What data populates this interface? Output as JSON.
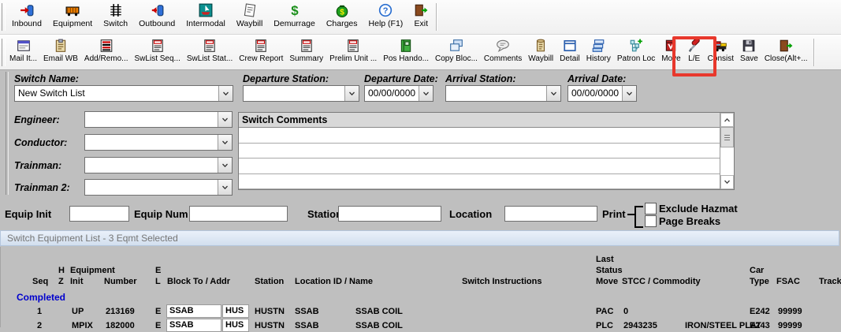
{
  "toolbar_main": {
    "items": [
      "Inbound",
      "Equipment",
      "Switch",
      "Outbound",
      "Intermodal",
      "Waybill",
      "Demurrage",
      "Charges",
      "Help (F1)",
      "Exit"
    ]
  },
  "toolbar_secondary": {
    "items": [
      "Mail It...",
      "Email WB",
      "Add/Remo...",
      "SwList Seq...",
      "SwList Stat...",
      "Crew Report",
      "Summary",
      "Prelim Unit ...",
      "Pos Hando...",
      "Copy Bloc...",
      "Comments",
      "Waybill",
      "Detail",
      "History",
      "Patron Loc",
      "Move",
      "L/E",
      "Consist",
      "Save",
      "Close(Alt+..."
    ],
    "highlighted_item": "L/E",
    "highlight_color": "#e8382c"
  },
  "form": {
    "switch_name": {
      "label": "Switch Name:",
      "value": "New Switch List"
    },
    "departure_station": {
      "label": "Departure Station:",
      "value": ""
    },
    "departure_date": {
      "label": "Departure Date:",
      "value": "00/00/0000"
    },
    "arrival_station": {
      "label": "Arrival Station:",
      "value": ""
    },
    "arrival_date": {
      "label": "Arrival Date:",
      "value": "00/00/0000"
    },
    "engineer": {
      "label": "Engineer:",
      "value": ""
    },
    "conductor": {
      "label": "Conductor:",
      "value": ""
    },
    "trainman": {
      "label": "Trainman:",
      "value": ""
    },
    "trainman2": {
      "label": "Trainman 2:",
      "value": ""
    },
    "comments": {
      "title": "Switch Comments",
      "rows": [
        "",
        "",
        "",
        ""
      ]
    }
  },
  "filter_row": {
    "equip_init_label": "Equip Init",
    "equip_num_label": "Equip Num",
    "station_label": "Station",
    "location_label": "Location",
    "print_label": "Print",
    "exclude_hazmat_label": "Exclude Hazmat",
    "page_breaks_label": "Page Breaks"
  },
  "equipment_list": {
    "title": "Switch Equipment List - 3 Eqmt Selected",
    "header": {
      "seq": "Seq",
      "h": "H",
      "z": "Z",
      "equipment": "Equipment",
      "init": "Init",
      "number": "Number",
      "e": "E",
      "l": "L",
      "block_to_addr": "Block To /  Addr",
      "station": "Station",
      "location": "Location ID / Name",
      "instructions": "Switch Instructions",
      "last": "Last",
      "status": "Status",
      "move": "Move",
      "stcc": "STCC / Commodity",
      "car": "Car",
      "type": "Type",
      "fsac": "FSAC",
      "track": "Track"
    },
    "group_label": "Completed",
    "rows": [
      {
        "seq": "1",
        "init": "UP",
        "number": "213169",
        "el": "E",
        "block_to": "SSAB",
        "addr": "HUS",
        "station": "HUSTN",
        "location_id": "SSAB",
        "location_name": "SSAB COIL",
        "last_status_move": "PAC",
        "stcc": "0",
        "commodity": "",
        "car_type": "E242",
        "fsac": "99999",
        "track": ""
      },
      {
        "seq": "2",
        "init": "MPIX",
        "number": "182000",
        "el": "E",
        "block_to": "SSAB",
        "addr": "HUS",
        "station": "HUSTN",
        "location_id": "SSAB",
        "location_name": "SSAB COIL",
        "last_status_move": "PLC",
        "stcc": "2943235",
        "commodity": "IRON/STEEL PLAT",
        "car_type": "E243",
        "fsac": "99999",
        "track": ""
      }
    ]
  },
  "colors": {
    "panel_bg": "#bfbfbf",
    "completed_blue": "#0000cd",
    "annotation_red": "#e8382c",
    "listbar_text": "#757575"
  }
}
